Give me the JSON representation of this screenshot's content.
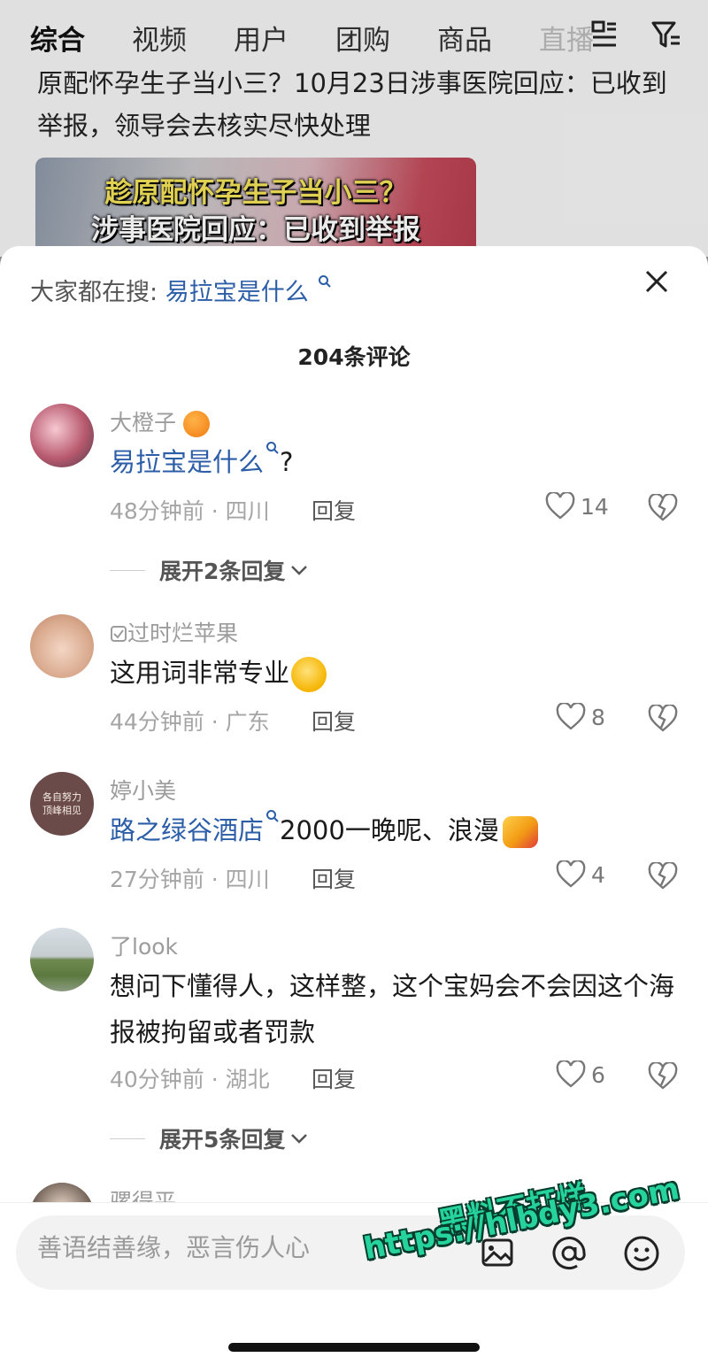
{
  "tabs": [
    "综合",
    "视频",
    "用户",
    "团购",
    "商品",
    "直播"
  ],
  "background_post": {
    "headline": "原配怀孕生子当小三？10月23日涉事医院回应：已收到举报，领导会去核实尽快处理",
    "thumbnail_lines": [
      "趁原配怀孕生子当小三？",
      "涉事医院回应：已收到举报"
    ]
  },
  "sheet": {
    "hot_search_prefix": "大家都在搜:",
    "hot_search_keyword": "易拉宝是什么",
    "comment_count": "204条评论"
  },
  "comments": [
    {
      "username": "大橙子",
      "text_link": "易拉宝是什么",
      "text": "?",
      "time_location": "48分钟前 · 四川",
      "reply_label": "回复",
      "likes": "14",
      "expand_label": "展开2条回复"
    },
    {
      "username": "过时烂苹果",
      "text": "这用词非常专业",
      "time_location": "44分钟前 · 广东",
      "reply_label": "回复",
      "likes": "8"
    },
    {
      "username": "婷小美",
      "avatar_text": "各自努力 顶峰相见",
      "text_link": "路之绿谷酒店",
      "text": "2000一晚呢、浪漫",
      "time_location": "27分钟前 · 四川",
      "reply_label": "回复",
      "likes": "4"
    },
    {
      "username": "了look",
      "text": "想问下懂得人，这样整，这个宝妈会不会因这个海报被拘留或者罚款",
      "time_location": "40分钟前 · 湖北",
      "reply_label": "回复",
      "likes": "6",
      "expand_label": "展开5条回复"
    },
    {
      "username": "骡得平"
    }
  ],
  "input": {
    "placeholder": "善语结善缘，恶言伤人心"
  },
  "watermark": {
    "line1": "黑料不打烊",
    "line2": "https://hlbdy3.com"
  },
  "colors": {
    "link_blue": "#2c5ea8",
    "watermark_green": "#27d39c"
  }
}
